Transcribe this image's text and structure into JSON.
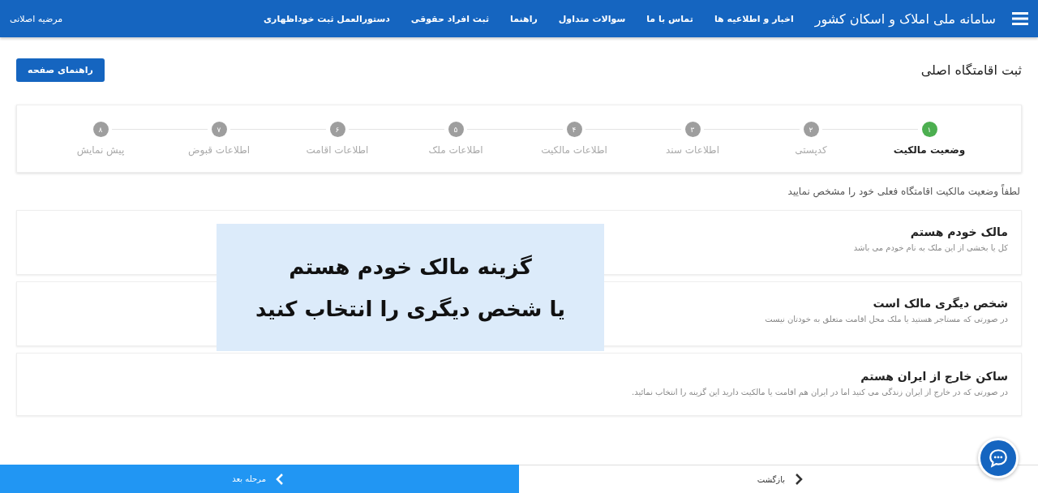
{
  "header": {
    "title": "سامانه ملی املاک و اسکان کشور",
    "nav": [
      "اخبار و اطلاعیه ها",
      "تماس با ما",
      "سوالات متداول",
      "راهنما",
      "ثبت افراد حقوقی",
      "دستورالعمل ثبت خوداظهاری"
    ],
    "user": "مرضیه اصلانی"
  },
  "page": {
    "title": "ثبت اقامتگاه اصلی",
    "help_button": "راهنمای صفحه"
  },
  "steps": [
    {
      "number": "۱",
      "label": "وضعیت مالکیت",
      "selected": true
    },
    {
      "number": "۲",
      "label": "کدپستی",
      "selected": false
    },
    {
      "number": "۳",
      "label": "اطلاعات سند",
      "selected": false
    },
    {
      "number": "۴",
      "label": "اطلاعات مالکیت",
      "selected": false
    },
    {
      "number": "۵",
      "label": "اطلاعات ملک",
      "selected": false
    },
    {
      "number": "۶",
      "label": "اطلاعات اقامت",
      "selected": false
    },
    {
      "number": "۷",
      "label": "اطلاعات قبوض",
      "selected": false
    },
    {
      "number": "۸",
      "label": "پیش نمایش",
      "selected": false
    }
  ],
  "instruction": "لطفاً وضعیت مالکیت اقامتگاه فعلی خود را مشخص نمایید",
  "options": [
    {
      "title": "مالک خودم هستم",
      "description": "کل یا بخشی از این ملک به نام خودم می باشد"
    },
    {
      "title": "شخص دیگری مالک است",
      "description": "در صورتی که مستاجر هستید یا ملک محل اقامت متعلق به خودتان نیست"
    },
    {
      "title": "ساکن خارج از ایران هستم",
      "description": "در صورتی که در خارج از ایران زندگی می کنید اما در ایران هم اقامت یا مالکیت دارید این گزینه را انتخاب نمائید."
    }
  ],
  "annotation": [
    "گزینه مالک خودم هستم",
    "یا شخص دیگری را انتخاب کنید"
  ],
  "footer": {
    "back": "بازگشت",
    "next": "مرحله بعد"
  }
}
